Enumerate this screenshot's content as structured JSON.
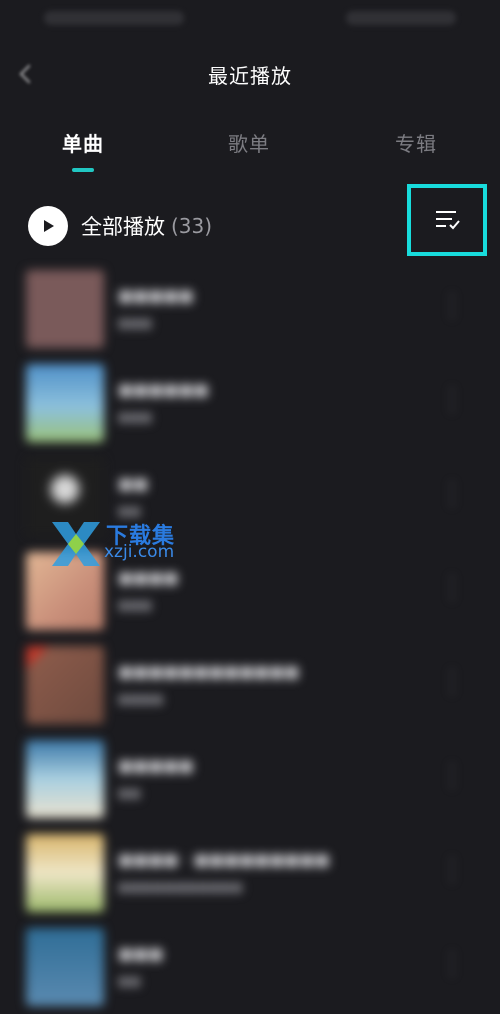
{
  "header": {
    "title": "最近播放"
  },
  "tabs": [
    {
      "label": "单曲",
      "active": true
    },
    {
      "label": "歌单",
      "active": false
    },
    {
      "label": "专辑",
      "active": false
    }
  ],
  "play_all": {
    "label": "全部播放",
    "count": "(33)"
  },
  "songs": [
    {
      "title": "■■■■■",
      "sub": "■■■",
      "thumb_color": "#7a5a5a"
    },
    {
      "title": "■■■■■■",
      "sub": "■■■",
      "thumb_color": "#5fa0c8"
    },
    {
      "title": "■■",
      "sub": "■■",
      "thumb_color": "#2a2a2a"
    },
    {
      "title": "■■■■",
      "sub": "■■■",
      "thumb_color": "#c9a58a"
    },
    {
      "title": "■■■■■■■■■■■■",
      "sub": "■■■■",
      "thumb_color": "#8a5a4a"
    },
    {
      "title": "■■■■■",
      "sub": "■■",
      "thumb_color": "#8fb9c9"
    },
    {
      "title": "■■■■ · ■■■■■■■■■",
      "sub": "■■■■■■■■■■■",
      "thumb_color": "#d8c89a"
    },
    {
      "title": "■■■",
      "sub": "■■",
      "thumb_color": "#5a8ab0"
    }
  ],
  "watermark": {
    "brand": "下载集",
    "domain": "xzji.com"
  },
  "colors": {
    "accent": "#21c7c2",
    "highlight_box": "#18dcdc",
    "background": "#1b1b1f"
  }
}
